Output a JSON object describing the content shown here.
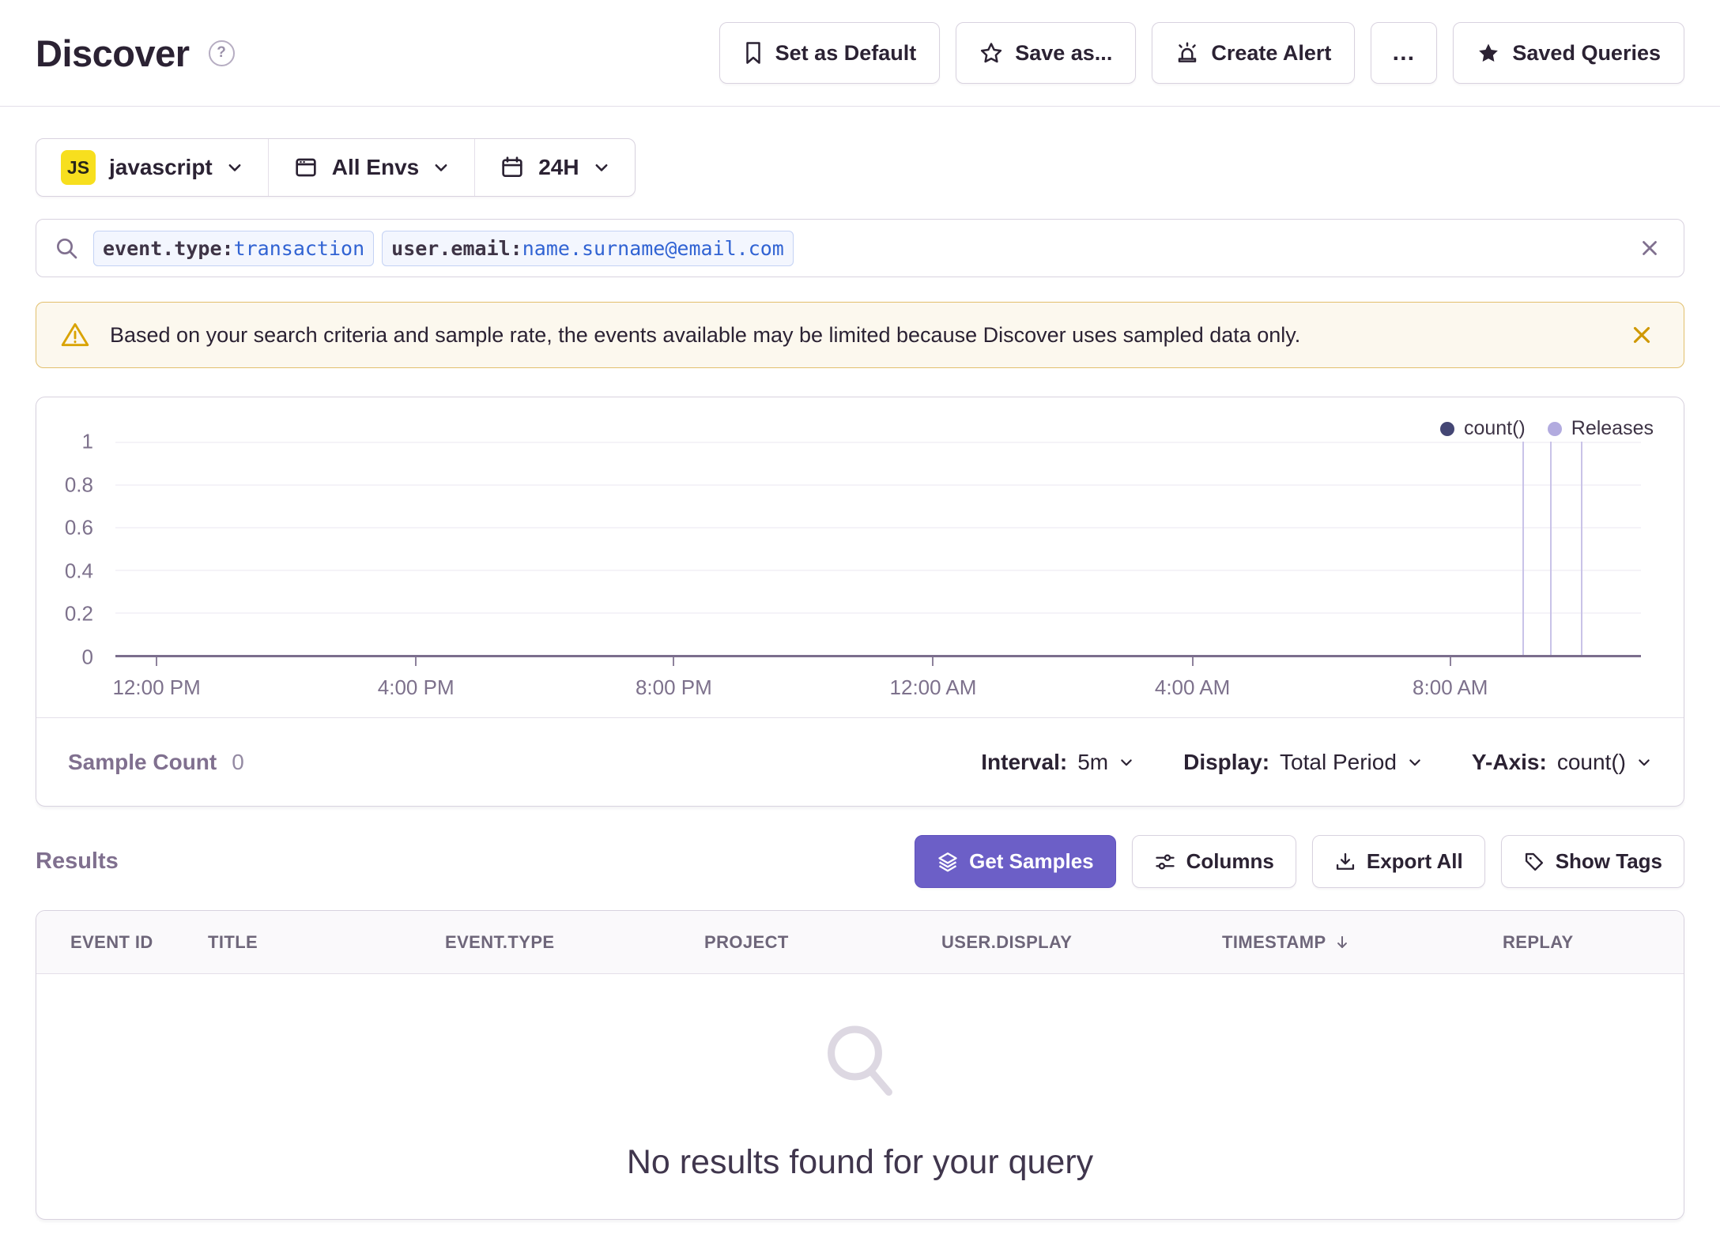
{
  "colors": {
    "accent_purple": "#6c5fc7",
    "warning_gold": "#cf9802",
    "banner_bg": "#fcf8ee",
    "banner_border": "#e2bf6d"
  },
  "header": {
    "title": "Discover",
    "help_icon": "?",
    "buttons": {
      "set_default": "Set as Default",
      "save_as": "Save as...",
      "create_alert": "Create Alert",
      "more": "…",
      "saved_queries": "Saved Queries"
    }
  },
  "filters": {
    "project": {
      "badge": "JS",
      "label": "javascript"
    },
    "environment": {
      "label": "All Envs"
    },
    "period": {
      "label": "24H"
    }
  },
  "search": {
    "tokens": [
      {
        "key": "event.type:",
        "value": "transaction"
      },
      {
        "key": "user.email:",
        "value": "name.surname@email.com"
      }
    ]
  },
  "banner": {
    "message": "Based on your search criteria and sample rate, the events available may be limited because Discover uses sampled data only."
  },
  "chart_data": {
    "type": "line",
    "title": "",
    "series": [
      {
        "name": "count()",
        "values": []
      }
    ],
    "ylim": [
      0,
      1
    ],
    "y_ticks": [
      "1",
      "0.8",
      "0.6",
      "0.4",
      "0.2",
      "0"
    ],
    "x_ticks": [
      "12:00 PM",
      "4:00 PM",
      "8:00 PM",
      "12:00 AM",
      "4:00 AM",
      "8:00 AM"
    ],
    "x_tick_pct": [
      2.7,
      19.7,
      36.6,
      53.6,
      70.6,
      87.5
    ],
    "legend": [
      {
        "label": "count()",
        "color": "#444674"
      },
      {
        "label": "Releases",
        "color": "#b2abdf"
      }
    ],
    "releases": {
      "count": 3,
      "positions_pct": [
        92.3,
        94.1,
        96.1
      ]
    },
    "grid": true,
    "legend_position": "top-right"
  },
  "chart_footer": {
    "sample_count_label": "Sample Count",
    "sample_count_value": "0",
    "interval_label": "Interval:",
    "interval_value": "5m",
    "display_label": "Display:",
    "display_value": "Total Period",
    "yaxis_label": "Y-Axis:",
    "yaxis_value": "count()"
  },
  "results": {
    "heading": "Results",
    "get_samples": "Get Samples",
    "columns_btn": "Columns",
    "export_all": "Export All",
    "show_tags": "Show Tags",
    "table": {
      "columns": [
        "EVENT ID",
        "TITLE",
        "EVENT.TYPE",
        "PROJECT",
        "USER.DISPLAY",
        "TIMESTAMP",
        "REPLAY"
      ],
      "sort": {
        "column": "TIMESTAMP",
        "direction": "desc"
      },
      "rows": [],
      "empty_message": "No results found for your query"
    }
  }
}
